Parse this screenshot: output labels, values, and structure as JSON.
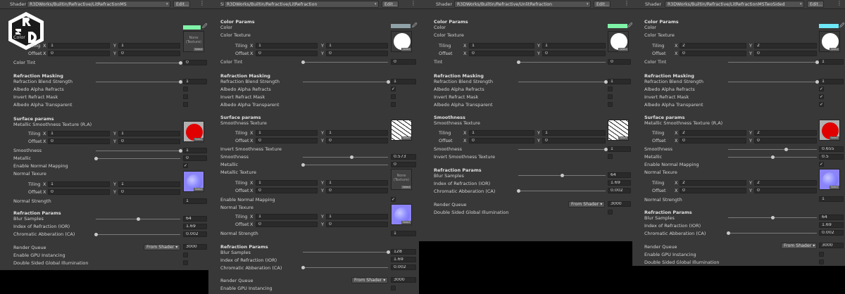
{
  "labels": {
    "shader": "Shader",
    "edit": "Edit...",
    "x": "X",
    "y": "Y",
    "none": "None",
    "texture": "(Texture)",
    "select": "Select",
    "check": "✓",
    "caret": "▾",
    "menu": "⋮",
    "eyedropper": "🖉"
  },
  "colors": {
    "green": "#7ff3a8",
    "lightblue": "#6de8f8",
    "gray": "#8fa3a8"
  },
  "panels": [
    {
      "id": "p1",
      "shader": "R3DWorks/Builtin/Refractive/LitRefractionMS",
      "texts": [
        "Color",
        "Tiling",
        "Offset",
        "Color Tint",
        "Refraction Masking",
        "Refraction Blend Strength",
        "Albedo Alpha Refracts",
        "Invert Refract Mask",
        "Albedo Alpha Transparent",
        "Surface params",
        "Metallic Smoothness Texture (R,A)",
        "Tiling",
        "Offset",
        "Smoothness",
        "Metallic",
        "Enable Normal Mapping",
        "Normal Texure",
        "Tiling",
        "Offset",
        "Normal Strength",
        "Refraction Params",
        "Blur Samples",
        "Index of Refraction (IOR)",
        "Chromatic Abberation (CA)",
        "Render Queue",
        "Enable GPU Instancing",
        "Double Sided Global Illumination"
      ],
      "fields": [
        "1",
        "1",
        "0",
        "0",
        "0",
        "1",
        "1",
        "1",
        "0",
        "0",
        "1",
        "0",
        "1",
        "1",
        "0",
        "0",
        "1",
        "64",
        "1.69",
        "0.002",
        "3000"
      ],
      "renderQueueMode": "From Shader"
    },
    {
      "id": "p2",
      "shader": "R3DWorks/Builtin/Refractive/LitRefraction",
      "texts": [
        "Color Params",
        "Color",
        "Color Texture",
        "Tiling",
        "Offset",
        "Color Tint",
        "Refraction Masking",
        "Refraction Blend Strength",
        "Albedo Alpha Refracts",
        "Invert Refract Mask",
        "Albedo Alpha Transparent",
        "Surface params",
        "Smoothness Texture",
        "Tiling",
        "Offset",
        "Invert Smoothness Texture",
        "Smoothness",
        "Metallic",
        "Metallic Texture",
        "Tiling",
        "Offset",
        "Enable Normal Mapping",
        "Normal Texure",
        "Tiling",
        "Offset",
        "Normal Strength",
        "Refraction Params",
        "Blur Samples",
        "Index of Refraction (IOR)",
        "Chromatic Abberation (CA)",
        "Render Queue",
        "Enable GPU Instancing"
      ],
      "fields": [
        "1",
        "1",
        "0",
        "0",
        "0",
        "1",
        "1",
        "1",
        "0",
        "0",
        "0.573",
        "0",
        "1",
        "1",
        "0",
        "0",
        "1",
        "1",
        "0",
        "0",
        "1",
        "128",
        "1.69",
        "0.002",
        "3000"
      ],
      "renderQueueMode": "From Shader"
    },
    {
      "id": "p3",
      "shader": "R3DWorks/Builtin/Refractive/UnlitRefraction",
      "texts": [
        "Color Params",
        "Color",
        "Color Texture",
        "Tiling",
        "Offset",
        "Tint",
        "Refraction Masking",
        "Refraction Blend Strength",
        "Albedo Alpha Refracts",
        "Invert Refract Mask",
        "Albedo Alpha Transparent",
        "Smoothness",
        "Smoothness Texture",
        "Tiling",
        "Offset",
        "Smoothness",
        "Invert Smoothness Texture",
        "Refraction Params",
        "Blur Samples",
        "Index of Refraction (IOR)",
        "Chromatic Abberation (CA)",
        "Render Queue",
        "Double Sided Global Illumination"
      ],
      "fields": [
        "1",
        "1",
        "0",
        "0",
        "0",
        "1",
        "1",
        "1",
        "0",
        "0",
        "1",
        "64",
        "1.69",
        "0.002",
        "3000"
      ],
      "renderQueueMode": "From Shader"
    },
    {
      "id": "p4",
      "shader": "R3DWorks/Builtin/Refractive/LitRefractionMSTwoSided",
      "texts": [
        "Color Params",
        "Color",
        "Color Texture",
        "Tiling",
        "Offset",
        "Color Tint",
        "Refraction Masking",
        "Refraction Blend Strength",
        "Albedo Alpha Refracts",
        "Invert Refract Mask",
        "Albedo Alpha Transparent",
        "Surface params",
        "Metallic Smoothness Texture (R,A)",
        "Tiling",
        "Offset",
        "Smoothness",
        "Metallic",
        "Enable Normal Mapping",
        "Normal Texure",
        "Tiling",
        "Offset",
        "Normal Strength",
        "Refraction Params",
        "Blur Samples",
        "Index of Refraction (IOR)",
        "Chromatic Abberation (CA)",
        "Render Queue",
        "Enable GPU Instancing",
        "Double Sided Global Illumination"
      ],
      "fields": [
        "2",
        "2",
        "0",
        "0",
        "1",
        "1",
        "2",
        "2",
        "0",
        "0",
        "0.655",
        "0.5",
        "2",
        "2",
        "0",
        "0",
        "1",
        "64",
        "1.69",
        "0.002",
        "3000"
      ],
      "renderQueueMode": "From Shader"
    }
  ],
  "sliders": {
    "p1": [
      1.0,
      1.0,
      1.0,
      0.0,
      0.5,
      0.0
    ],
    "p2": [
      0.0,
      1.0,
      0.573,
      0.0,
      1.0,
      0.0
    ],
    "p3": [
      0.0,
      1.0,
      1.0,
      0.5,
      0.0
    ],
    "p4": [
      1.0,
      1.0,
      0.655,
      0.5,
      0.5,
      0.0
    ]
  }
}
